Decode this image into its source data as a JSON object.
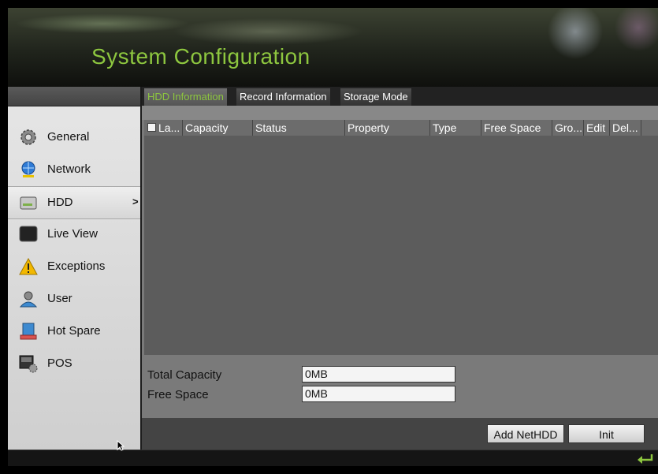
{
  "header": {
    "title": "System Configuration"
  },
  "sidebar": {
    "items": [
      {
        "label": "General",
        "icon": "gear-icon"
      },
      {
        "label": "Network",
        "icon": "network-globe-icon"
      },
      {
        "label": "HDD",
        "icon": "hdd-icon",
        "active": true,
        "arrow": ">"
      },
      {
        "label": "Live View",
        "icon": "monitor-icon"
      },
      {
        "label": "Exceptions",
        "icon": "warning-icon"
      },
      {
        "label": "User",
        "icon": "user-icon"
      },
      {
        "label": "Hot Spare",
        "icon": "hot-spare-icon"
      },
      {
        "label": "POS",
        "icon": "pos-icon"
      }
    ]
  },
  "tabs": [
    {
      "label": "HDD Information",
      "active": true
    },
    {
      "label": "Record Information"
    },
    {
      "label": "Storage Mode"
    }
  ],
  "table": {
    "columns": [
      "La...",
      "Capacity",
      "Status",
      "Property",
      "Type",
      "Free Space",
      "Gro...",
      "Edit",
      "Del..."
    ],
    "rows": []
  },
  "summary": {
    "total_capacity_label": "Total Capacity",
    "total_capacity_value": "0MB",
    "free_space_label": "Free Space",
    "free_space_value": "0MB"
  },
  "buttons": {
    "add_nethdd": "Add NetHDD",
    "init": "Init"
  },
  "colors": {
    "accent": "#8dc63f",
    "panel": "#7a7a7a",
    "table_bg": "#5c5c5c"
  }
}
